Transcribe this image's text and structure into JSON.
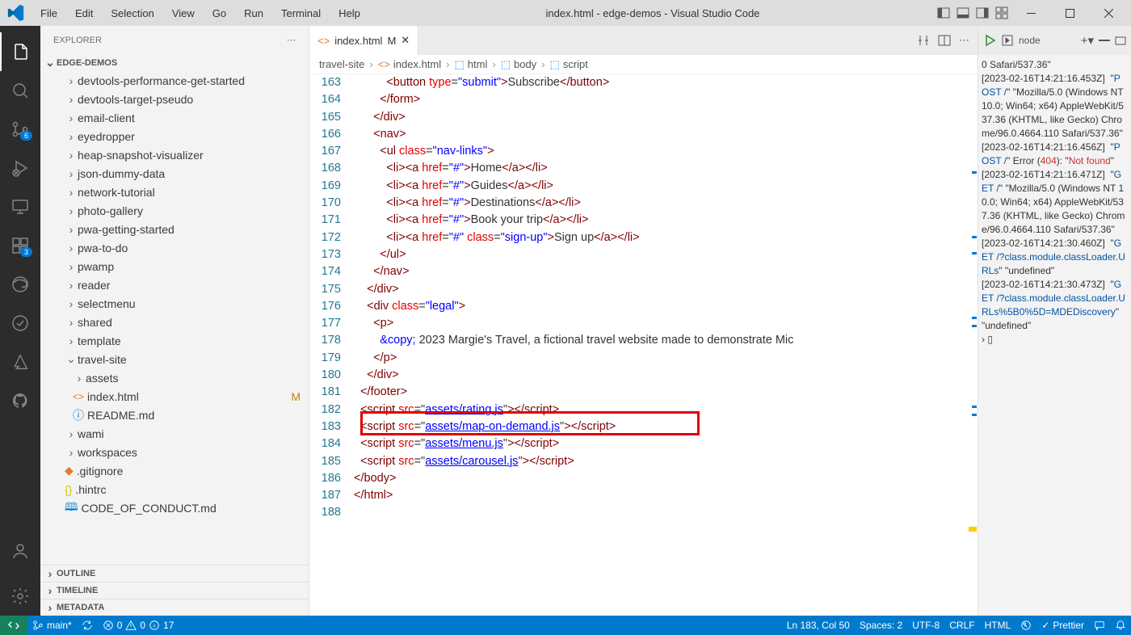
{
  "menu": [
    "File",
    "Edit",
    "Selection",
    "View",
    "Go",
    "Run",
    "Terminal",
    "Help"
  ],
  "title": "index.html - edge-demos - Visual Studio Code",
  "sidebar": {
    "title": "EXPLORER",
    "section": "EDGE-DEMOS",
    "items": [
      {
        "t": "folder",
        "label": "devtools-performance-get-started",
        "indent": 1
      },
      {
        "t": "folder",
        "label": "devtools-target-pseudo",
        "indent": 1
      },
      {
        "t": "folder",
        "label": "email-client",
        "indent": 1
      },
      {
        "t": "folder",
        "label": "eyedropper",
        "indent": 1
      },
      {
        "t": "folder",
        "label": "heap-snapshot-visualizer",
        "indent": 1
      },
      {
        "t": "folder",
        "label": "json-dummy-data",
        "indent": 1
      },
      {
        "t": "folder",
        "label": "network-tutorial",
        "indent": 1
      },
      {
        "t": "folder",
        "label": "photo-gallery",
        "indent": 1
      },
      {
        "t": "folder",
        "label": "pwa-getting-started",
        "indent": 1
      },
      {
        "t": "folder",
        "label": "pwa-to-do",
        "indent": 1
      },
      {
        "t": "folder",
        "label": "pwamp",
        "indent": 1
      },
      {
        "t": "folder",
        "label": "reader",
        "indent": 1
      },
      {
        "t": "folder",
        "label": "selectmenu",
        "indent": 1
      },
      {
        "t": "folder",
        "label": "shared",
        "indent": 1
      },
      {
        "t": "folder",
        "label": "template",
        "indent": 1
      },
      {
        "t": "folder-open",
        "label": "travel-site",
        "indent": 1,
        "dot": true
      },
      {
        "t": "folder",
        "label": "assets",
        "indent": 2,
        "dot": true
      },
      {
        "t": "html",
        "label": "index.html",
        "indent": 2,
        "mod": "M"
      },
      {
        "t": "info",
        "label": "README.md",
        "indent": 2
      },
      {
        "t": "folder",
        "label": "wami",
        "indent": 1
      },
      {
        "t": "folder",
        "label": "workspaces",
        "indent": 1
      },
      {
        "t": "git",
        "label": ".gitignore",
        "indent": 1
      },
      {
        "t": "json",
        "label": ".hintrc",
        "indent": 1
      },
      {
        "t": "md",
        "label": "CODE_OF_CONDUCT.md",
        "indent": 1
      }
    ],
    "panels": [
      "OUTLINE",
      "TIMELINE",
      "METADATA"
    ]
  },
  "tab": {
    "name": "index.html",
    "mod": "M",
    "bc": [
      "travel-site",
      "index.html",
      "html",
      "body",
      "script"
    ]
  },
  "lines": {
    "start": 163,
    "end": 188
  },
  "status": {
    "branch": "main*",
    "errs": "0",
    "warns": "0",
    "info": "17",
    "ln": "Ln 183, Col 50",
    "spaces": "Spaces: 2",
    "enc": "UTF-8",
    "eol": "CRLF",
    "lang": "HTML",
    "prettier": "Prettier"
  },
  "debug": {
    "launch": "node"
  }
}
